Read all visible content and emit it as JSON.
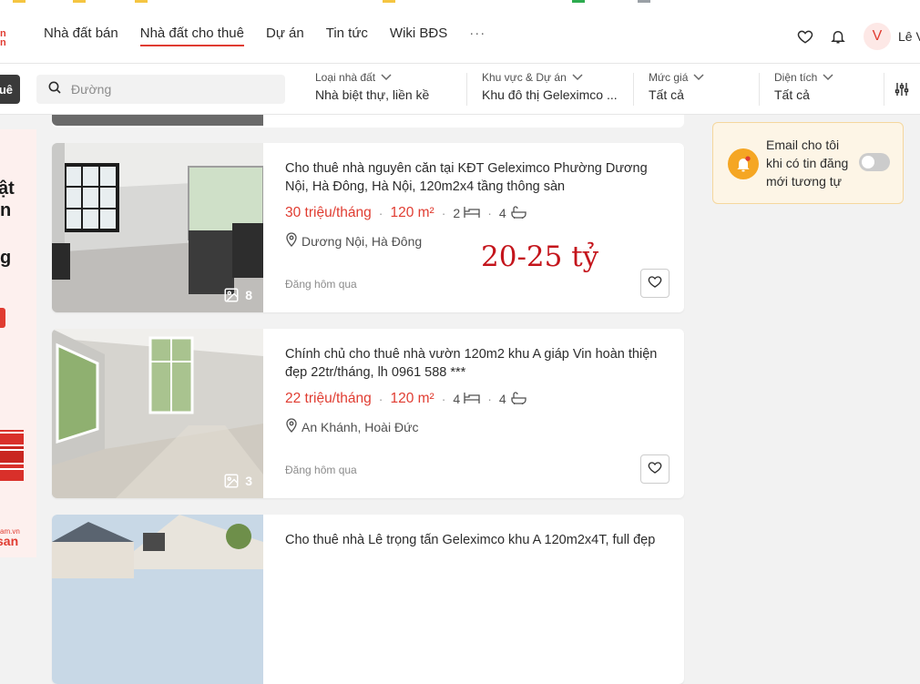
{
  "header": {
    "nav": [
      {
        "label": "Nhà đất bán"
      },
      {
        "label": "Nhà đất cho thuê"
      },
      {
        "label": "Dự án"
      },
      {
        "label": "Tin tức"
      },
      {
        "label": "Wiki BĐS"
      }
    ],
    "more": "···",
    "avatar_initial": "V",
    "username": "Lê V"
  },
  "filters": {
    "left_button": "uê",
    "search_placeholder": "Đường",
    "items": [
      {
        "label": "Loại nhà đất",
        "value": "Nhà biệt thự, liền kề"
      },
      {
        "label": "Khu vực & Dự án",
        "value": "Khu đô thị Geleximco ..."
      },
      {
        "label": "Mức giá",
        "value": "Tất cả"
      },
      {
        "label": "Diện tích",
        "value": "Tất cả"
      }
    ]
  },
  "left_banner": {
    "line1": "ật",
    "line2": "n",
    "line3": "g",
    "brand_small": "am.vn",
    "brand": "san"
  },
  "listings": [
    {
      "title": "Cho thuê nhà nguyên căn tại KĐT Geleximco Phường Dương Nội, Hà Đông, Hà Nội, 120m2x4 tầng thông sàn",
      "price": "30 triệu/tháng",
      "area": "120 m²",
      "bedrooms": "2",
      "bathrooms": "4",
      "location": "Dương Nội, Hà Đông",
      "posted": "Đăng hôm qua",
      "photo_count": "8"
    },
    {
      "title": "Chính chủ cho thuê nhà vườn 120m2 khu A giáp Vin hoàn thiện đẹp 22tr/tháng, lh 0961 588 ***",
      "price": "22 triệu/tháng",
      "area": "120 m²",
      "bedrooms": "4",
      "bathrooms": "4",
      "location": "An Khánh, Hoài Đức",
      "posted": "Đăng hôm qua",
      "photo_count": "3"
    },
    {
      "title": "Cho thuê nhà Lê trọng tấn Geleximco khu A 120m2x4T, full đẹp"
    }
  ],
  "overlay_text": "20-25 tỷ",
  "alert": {
    "text": "Email cho tôi khi có tin đăng mới tương tự"
  },
  "colors": {
    "accent": "#e03c31",
    "alert_bg": "#fdf5e6"
  }
}
